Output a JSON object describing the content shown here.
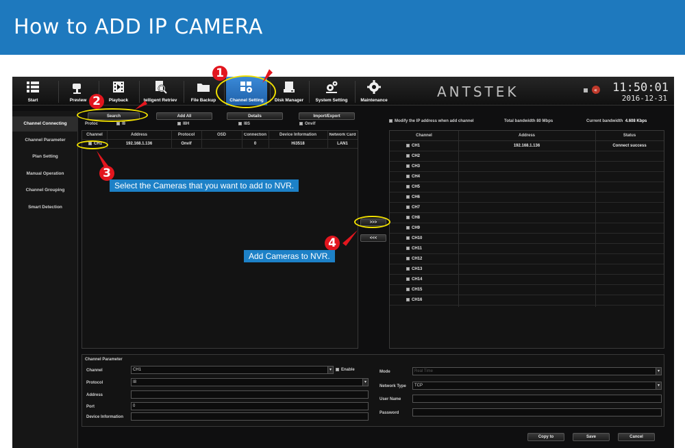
{
  "banner": {
    "title": "How to ADD IP CAMERA"
  },
  "toolbar": {
    "items": [
      {
        "label": "Start",
        "icon": "menu-icon"
      },
      {
        "label": "Preview",
        "icon": "camera-icon"
      },
      {
        "label": "Playback",
        "icon": "film-icon"
      },
      {
        "label": "telligent Retriev",
        "icon": "doc-search-icon"
      },
      {
        "label": "File Backup",
        "icon": "folder-icon"
      },
      {
        "label": "Channel Setting",
        "icon": "grid-gear-icon"
      },
      {
        "label": "Disk Manager",
        "icon": "disk-icon"
      },
      {
        "label": "System Setting",
        "icon": "gears-icon"
      },
      {
        "label": "Maintenance",
        "icon": "gear-icon"
      }
    ],
    "brand": "ANTSTEK",
    "time": "11:50:01",
    "date": "2016-12-31"
  },
  "sidebar": {
    "items": [
      {
        "label": "Channel Connecting"
      },
      {
        "label": "Channel Parameter"
      },
      {
        "label": "Plan Setting"
      },
      {
        "label": "Manual Operation"
      },
      {
        "label": "Channel Grouping"
      },
      {
        "label": "Smart Detection"
      }
    ]
  },
  "search_panel": {
    "buttons": {
      "search": "Search",
      "add_all": "Add All",
      "details": "Details",
      "import_export": "Import/Export"
    },
    "protocol_filter": {
      "label": "Protoc",
      "options": [
        "I8",
        "I8H",
        "I8S",
        "Onvif"
      ]
    },
    "headers": [
      "Channel",
      "Address",
      "Protocol",
      "OSD",
      "Connection",
      "Device Information",
      "Network Card"
    ],
    "rows": [
      {
        "channel": "CH1",
        "address": "192.168.1.136",
        "protocol": "Onvif",
        "osd": "",
        "connection": "0",
        "device": "Hi3518",
        "network": "LAN1"
      }
    ]
  },
  "transfer": {
    "add": ">>>",
    "remove": "<<<"
  },
  "right_panel": {
    "modify_label": "Modify the IP address when add channel",
    "total_bandwidth": "Total bandwidth  80 Mbps",
    "current_bandwidth_label": "Current bandwidth",
    "current_bandwidth_value": "4.608 Kbps",
    "headers": [
      "Channel",
      "Address",
      "Status"
    ],
    "rows": [
      {
        "channel": "CH1",
        "address": "192.168.1.136",
        "status": "Connect success"
      },
      {
        "channel": "CH2",
        "address": "",
        "status": ""
      },
      {
        "channel": "CH3",
        "address": "",
        "status": ""
      },
      {
        "channel": "CH4",
        "address": "",
        "status": ""
      },
      {
        "channel": "CH5",
        "address": "",
        "status": ""
      },
      {
        "channel": "CH6",
        "address": "",
        "status": ""
      },
      {
        "channel": "CH7",
        "address": "",
        "status": ""
      },
      {
        "channel": "CH8",
        "address": "",
        "status": ""
      },
      {
        "channel": "CH9",
        "address": "",
        "status": ""
      },
      {
        "channel": "CH10",
        "address": "",
        "status": ""
      },
      {
        "channel": "CH11",
        "address": "",
        "status": ""
      },
      {
        "channel": "CH12",
        "address": "",
        "status": ""
      },
      {
        "channel": "CH13",
        "address": "",
        "status": ""
      },
      {
        "channel": "CH14",
        "address": "",
        "status": ""
      },
      {
        "channel": "CH15",
        "address": "",
        "status": ""
      },
      {
        "channel": "CH16",
        "address": "",
        "status": ""
      }
    ]
  },
  "channel_parameter": {
    "title": "Channel Parameter",
    "channel_label": "Channel",
    "channel_value": "CH1",
    "enable_label": "Enable",
    "protocol_label": "Protocol",
    "protocol_value": "I8",
    "address_label": "Address",
    "address_value": "",
    "port_label": "Port",
    "port_value": "0",
    "device_info_label": "Device Information",
    "device_info_value": "",
    "mode_label": "Mode",
    "mode_value": "Real Time",
    "network_type_label": "Network Type",
    "network_type_value": "TCP",
    "user_name_label": "User Name",
    "user_name_value": "",
    "password_label": "Password",
    "password_value": ""
  },
  "footer": {
    "copy_to": "Copy to",
    "save": "Save",
    "cancel": "Cancel"
  },
  "annotations": {
    "steps": [
      "1",
      "2",
      "3",
      "4"
    ],
    "step3_text": "Select the Cameras that you want to add to NVR.",
    "step4_text": "Add Cameras to NVR."
  },
  "colors": {
    "banner": "#1e79be",
    "callout": "#1d81c7",
    "step_badge": "#e2161e",
    "highlight_ring": "#f1e000",
    "active_tab": "#2f74c0"
  }
}
